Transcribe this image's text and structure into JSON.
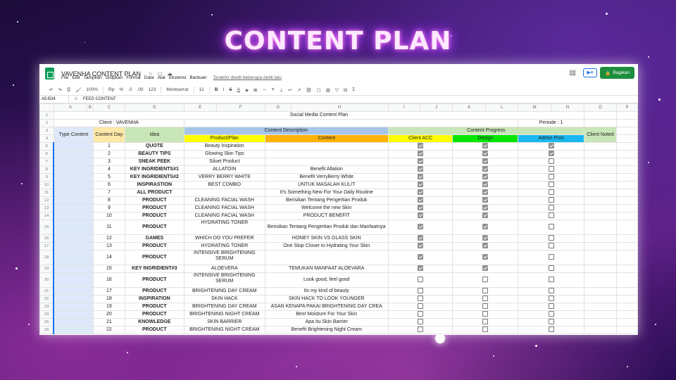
{
  "hero_title": "CONTENT PLAN",
  "app": {
    "doc_title": "VAVENHA CONTENT PLAN",
    "menus": [
      "File",
      "Edit",
      "Tampilan",
      "Sisipkan",
      "Format",
      "Data",
      "Alat",
      "Ekstensi",
      "Bantuan"
    ],
    "last_edit": "Terakhir diedit beberapa detik lalu",
    "share_label": "Bagikan",
    "toolbar": {
      "zoom": "100%",
      "currency": "Rp",
      "percent": "%",
      "dec1": ".0",
      "dec2": ".00",
      "numfmt": "123",
      "font": "Montserrat",
      "size": "12"
    },
    "name_box": "A5:B34",
    "formula": "FEED CONTENT"
  },
  "columns": [
    "",
    "A",
    "B",
    "C",
    "D",
    "E",
    "F",
    "G",
    "H",
    "I",
    "J",
    "K",
    "L",
    "M",
    "N",
    "O",
    "P"
  ],
  "sheet": {
    "title": "Social Media Content Plan",
    "client": "Client : VAVENHA",
    "periode": "Periode : 1",
    "content_description": "Content Description",
    "content_progress": "Content Progress",
    "headers": {
      "type_content": "Type Content",
      "content_day": "Content Day",
      "idea": "Idea",
      "product_plan": "Product/Plan",
      "content": "Content",
      "client_acc": "Client ACC",
      "design": "Design",
      "admin_post": "Admin Post",
      "client_noted": "Client Noted"
    },
    "colors": {
      "yellow": "#ffff00",
      "orange": "#ffb300",
      "green": "#00e600",
      "cyan": "#1ab8f0",
      "blue_hdr": "#a6c5e8",
      "light_green": "#c9e6b8",
      "light_yellow": "#fce8a8",
      "sel_blue": "#dde8f8"
    },
    "rows": [
      {
        "day": "1",
        "idea": "QUOTE",
        "product": "Beauty Inspiration",
        "content": "",
        "acc": true,
        "design": true,
        "admin": true
      },
      {
        "day": "2",
        "idea": "BEAUTY TIPS",
        "product": "Glowing Skin Tips",
        "content": "",
        "acc": true,
        "design": true,
        "admin": true
      },
      {
        "day": "3",
        "idea": "SNEAK PEEK",
        "product": "Siluet Product",
        "content": "",
        "acc": true,
        "design": true,
        "admin": false
      },
      {
        "day": "4",
        "idea": "KEY INGRIDIENTS#1",
        "product": "ALLATOIN",
        "content": "Benefit Allation",
        "acc": true,
        "design": true,
        "admin": false
      },
      {
        "day": "5",
        "idea": "KEY INGRIDIENTS#2",
        "product": "VERRY BERRY WHITE",
        "content": "Benefit VerryBerry White",
        "acc": true,
        "design": true,
        "admin": false
      },
      {
        "day": "6",
        "idea": "INSPIRASTION",
        "product": "BEST COMBO",
        "content": "UNTUK MASALAH KULIT",
        "acc": true,
        "design": true,
        "admin": false
      },
      {
        "day": "7",
        "idea": "ALL PRODUCT",
        "product": "",
        "content": "It's Something New For Your Daily Routine",
        "acc": true,
        "design": true,
        "admin": false
      },
      {
        "day": "8",
        "idea": "PRODUCT",
        "product": "CLEANING FACIAL WASH",
        "content": "Berisikan Tentang Pengertian Produk",
        "acc": true,
        "design": true,
        "admin": false
      },
      {
        "day": "9",
        "idea": "PRODUCT",
        "product": "CLEANING FACIAL WASH",
        "content": "Welcome the new Skin",
        "acc": true,
        "design": true,
        "admin": false
      },
      {
        "day": "10",
        "idea": "PRODUCT",
        "product": "CLEANING FACIAL WASH",
        "content": "PRODUCT BENEFIT",
        "acc": true,
        "design": true,
        "admin": false
      },
      {
        "day": "11",
        "idea": "PRODUCT",
        "product": "HYDRATING TONER",
        "content": "Berisikan Tentang Pengertian Produk dan Manfaatnya",
        "acc": true,
        "design": true,
        "admin": false,
        "tall": true
      },
      {
        "day": "12",
        "idea": "GAMES",
        "product": "WHICH DO YOU PREFER",
        "content": "HONEY SKIN VS GLASS SKIN",
        "acc": true,
        "design": true,
        "admin": false
      },
      {
        "day": "13",
        "idea": "PRODUCT",
        "product": "HYDRATING TONER",
        "content": "One Stop Closer to Hydrating Your Skin",
        "acc": true,
        "design": true,
        "admin": false
      },
      {
        "day": "14",
        "idea": "PRODUCT",
        "product": "INTENSIVE BRIGHTENING SERUM",
        "content": "",
        "acc": true,
        "design": true,
        "admin": false,
        "tall": true
      },
      {
        "day": "15",
        "idea": "KEY INGRIDIENT#3",
        "product": "ALOEVERA",
        "content": "TEMUKAN MANFAAT ALOEVARA",
        "acc": true,
        "design": true,
        "admin": false
      },
      {
        "day": "16",
        "idea": "PRODUCT",
        "product": "INTENSIVE BRIGHTENING SERUM",
        "content": "Look good, feel good",
        "acc": false,
        "design": false,
        "admin": false,
        "tall": true
      },
      {
        "day": "17",
        "idea": "PRODUCT",
        "product": "BRIGHTENING DAY CREAM",
        "content": "Its my kind of beauty",
        "acc": false,
        "design": false,
        "admin": false
      },
      {
        "day": "18",
        "idea": "INSPIRATION",
        "product": "SKIN HACK",
        "content": "SKIN HACK TO LOOK YOUNGER",
        "acc": false,
        "design": false,
        "admin": false
      },
      {
        "day": "19",
        "idea": "PRODUCT",
        "product": "BRIGHTENING DAY CREAM",
        "content": "ASAN KENAPA PAKAI BRIGHTENING DAY CREA",
        "acc": false,
        "design": false,
        "admin": false
      },
      {
        "day": "20",
        "idea": "PRODUCT",
        "product": "BRIGHTENING NIGHT CREAM",
        "content": "Best Moisture For Your Skin",
        "acc": false,
        "design": false,
        "admin": false
      },
      {
        "day": "21",
        "idea": "KNOWLEDGE",
        "product": "SKIN BARRIER",
        "content": "Apa itu Skin Barrier",
        "acc": false,
        "design": false,
        "admin": false
      },
      {
        "day": "22",
        "idea": "PRODUCT",
        "product": "BRIGHTENING NIGHT CREAM",
        "content": "Benefit Brightening Night Cream",
        "acc": false,
        "design": false,
        "admin": false
      }
    ]
  },
  "row_numbers": [
    "1",
    "2",
    "3",
    "4",
    "5",
    "6",
    "7",
    "8",
    "9",
    "10",
    "11",
    "12",
    "13",
    "14",
    "15",
    "16",
    "17",
    "18",
    "19",
    "20",
    "21",
    "22",
    "23",
    "24",
    "25",
    "26"
  ]
}
